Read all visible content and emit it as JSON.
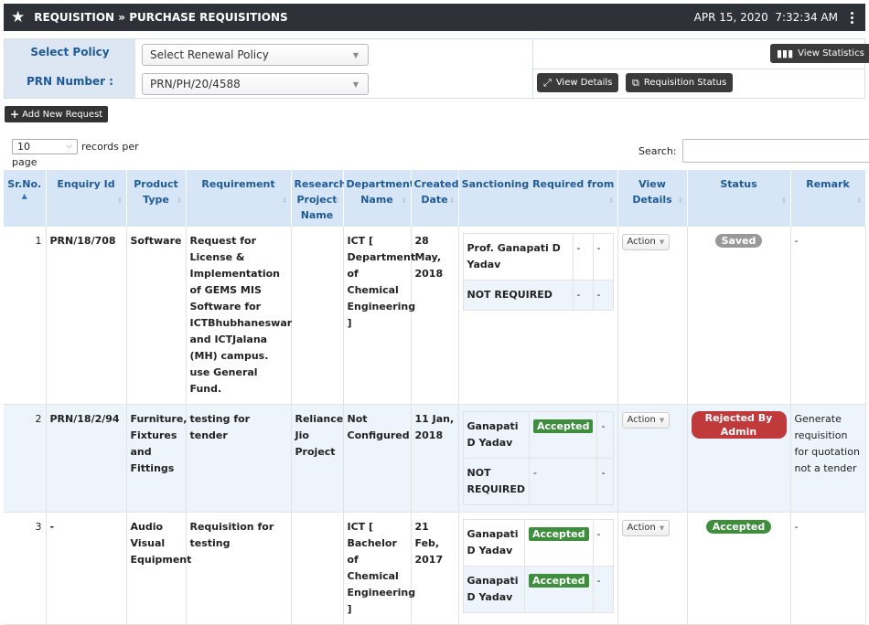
{
  "header": {
    "title": "REQUISITION » PURCHASE REQUISITIONS",
    "date": "APR 15, 2020",
    "time": "7:32:34 AM"
  },
  "filters": {
    "policy_label": "Select Policy",
    "policy_value": "Select Renewal Policy",
    "prn_label": "PRN Number :",
    "prn_value": "PRN/PH/20/4588"
  },
  "buttons": {
    "view_statistics": "View Statistics",
    "view_details": "View Details",
    "requisition_status": "Requisition Status",
    "add_new": "Add New Request"
  },
  "table_controls": {
    "length_value": "10",
    "records_per": "records per",
    "page": "page",
    "search_label": "Search:"
  },
  "columns": {
    "srno": "Sr.No.",
    "enquiry": "Enquiry Id",
    "product": "Product Type",
    "requirement": "Requirement",
    "project": "Research Project Name",
    "department": "Department Name",
    "created": "Created Date",
    "sanction": "Sanctioning Required from",
    "view": "View Details",
    "status": "Status",
    "remark": "Remark"
  },
  "rows": [
    {
      "sr": "1",
      "enquiry": "PRN/18/708",
      "product": "Software",
      "requirement": "Request for License & Implementation of GEMS MIS Software for ICTBhubhaneswar and ICTJalana (MH) campus. use General Fund.",
      "project": "",
      "department": "ICT [ Department of Chemical Engineering ]",
      "created": "28 May, 2018",
      "sanction": [
        {
          "name": "Prof. Ganapati D Yadav",
          "status": "-",
          "extra": "-"
        },
        {
          "name": "NOT REQUIRED",
          "status": "-",
          "extra": "-"
        }
      ],
      "action": "Action",
      "status": "Saved",
      "remark": "-"
    },
    {
      "sr": "2",
      "enquiry": "PRN/18/2/94",
      "product": "Furniture, Fixtures and Fittings",
      "requirement": "testing for tender",
      "project": "Reliance Jio Project",
      "department": "Not Configured",
      "created": "11 Jan, 2018",
      "sanction": [
        {
          "name": "Ganapati D Yadav",
          "status": "Accepted",
          "extra": "-"
        },
        {
          "name": "NOT REQUIRED",
          "status": "-",
          "extra": "-"
        }
      ],
      "action": "Action",
      "status": "Rejected By Admin",
      "remark": "Generate requisition for quotation not a tender"
    },
    {
      "sr": "3",
      "enquiry": "-",
      "product": "Audio Visual Equipment",
      "requirement": "Requisition for testing",
      "project": "",
      "department": "ICT [ Bachelor of Chemical Engineering ]",
      "created": "21 Feb, 2017",
      "sanction": [
        {
          "name": "Ganapati D Yadav",
          "status": "Accepted",
          "extra": "-"
        },
        {
          "name": "Ganapati D Yadav",
          "status": "Accepted",
          "extra": "-"
        }
      ],
      "action": "Action",
      "status": "Accepted",
      "remark": "-"
    }
  ]
}
